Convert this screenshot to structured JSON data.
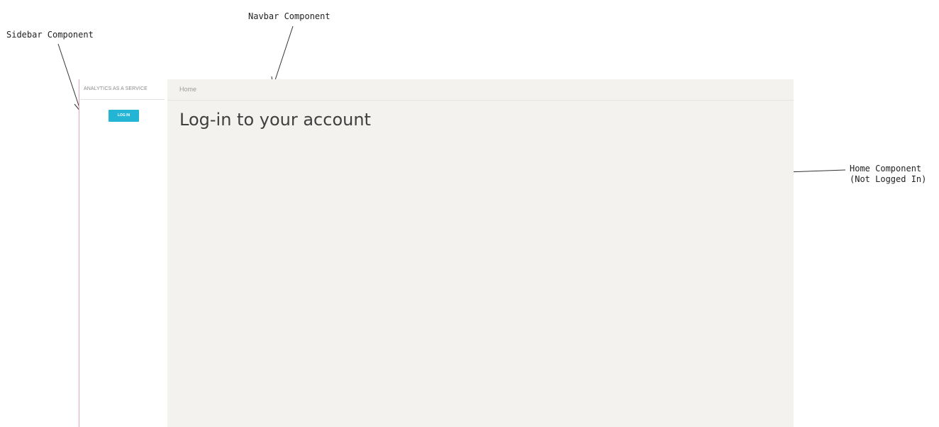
{
  "annotations": {
    "sidebar": "Sidebar Component",
    "navbar": "Navbar Component",
    "home_line1": "Home Component",
    "home_line2": "(Not Logged In)"
  },
  "sidebar": {
    "brand": "ANALYTICS AS A SERVICE",
    "login_label": "LOG IN"
  },
  "navbar": {
    "breadcrumb": "Home"
  },
  "main": {
    "title": "Log-in to your account"
  },
  "colors": {
    "accent": "#24b4d4",
    "sidebar_border": "#e7a6b4",
    "main_bg": "#f3f2ef"
  }
}
